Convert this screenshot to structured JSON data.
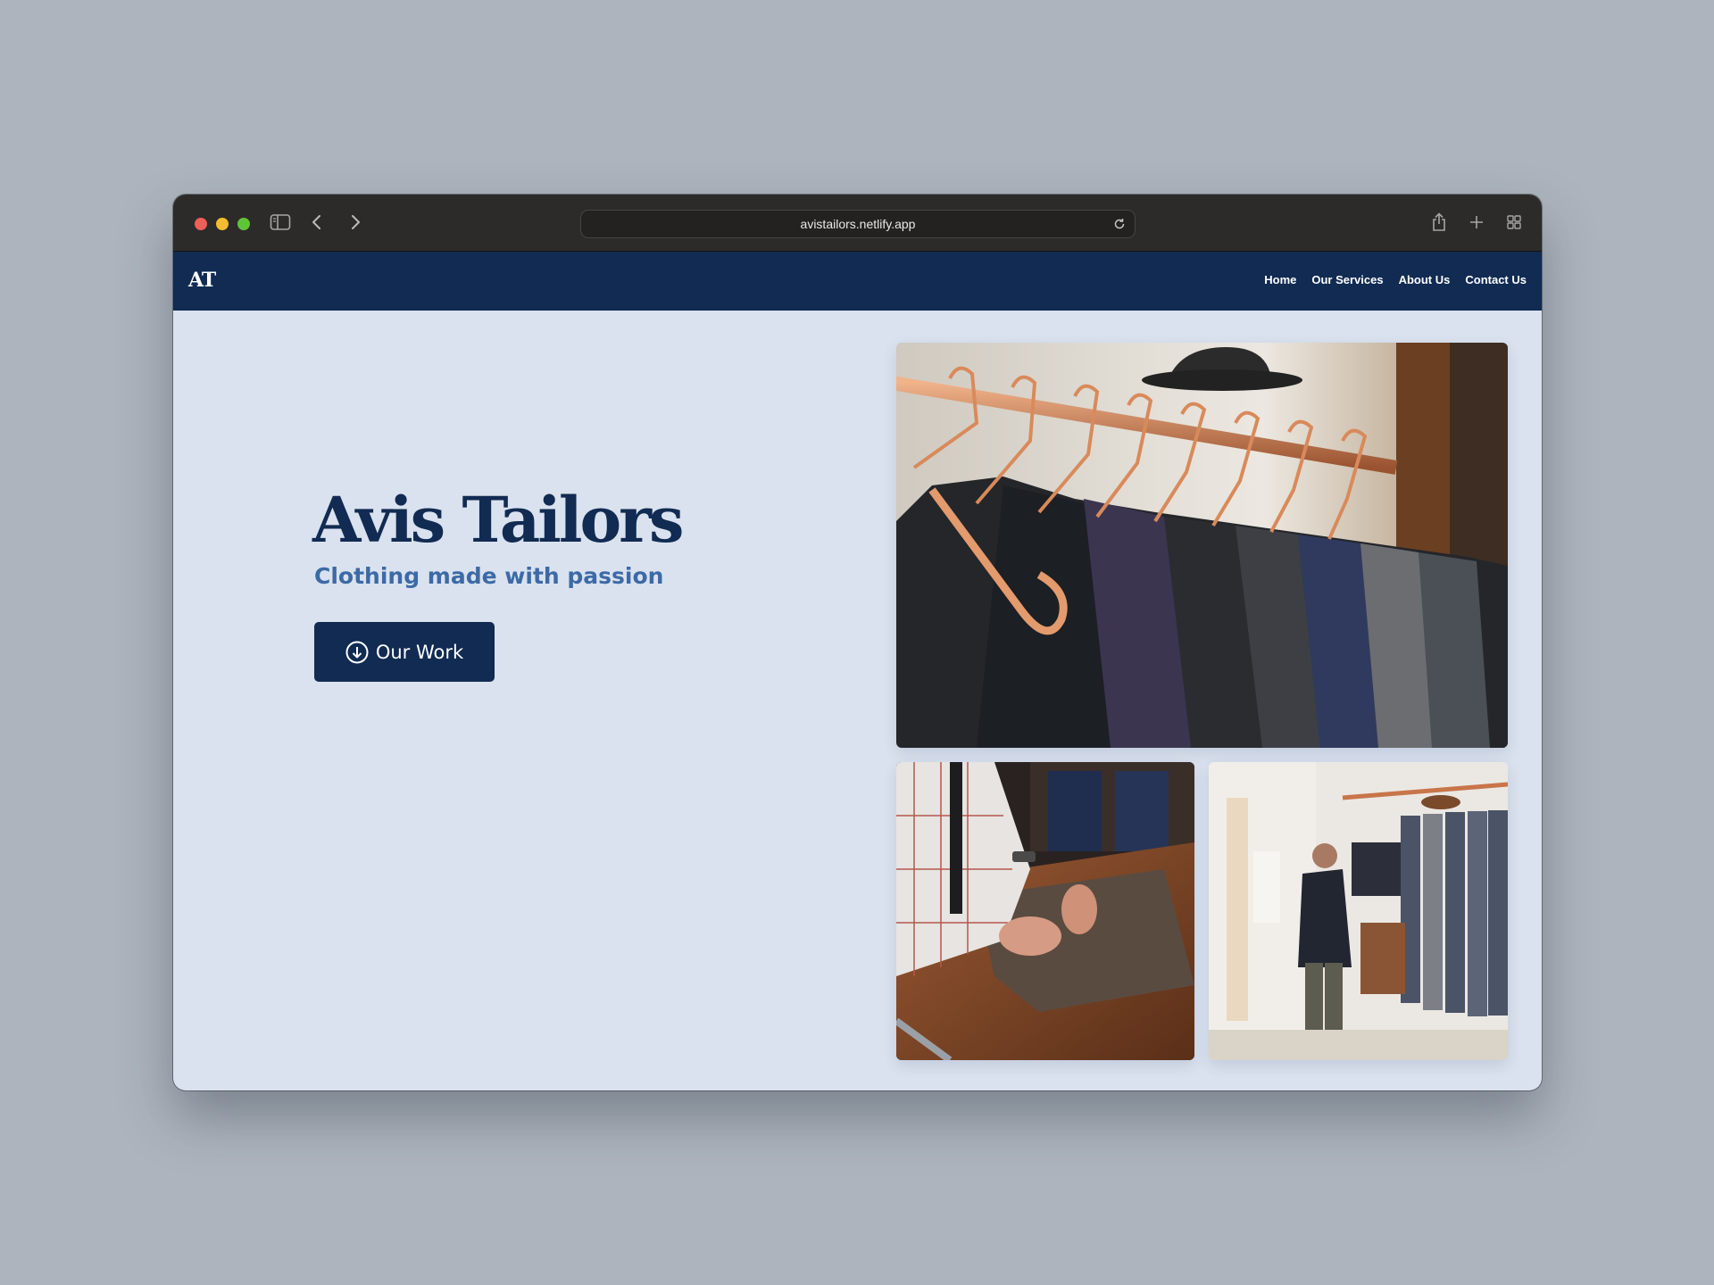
{
  "browser": {
    "url": "avistailors.netlify.app"
  },
  "site": {
    "logo": "AT",
    "nav": [
      "Home",
      "Our Services",
      "About Us",
      "Contact Us"
    ],
    "hero": {
      "title": "Avis Tailors",
      "subtitle": "Clothing made with passion",
      "cta_label": "Our Work"
    }
  },
  "colors": {
    "navy": "#112b52",
    "accent_blue": "#3c6aa6",
    "page_background": "#dae2ef"
  },
  "icons": {
    "cta": "arrow-down-circle-icon",
    "sidebar": "sidebar-icon",
    "back": "chevron-left-icon",
    "forward": "chevron-right-icon",
    "reload": "reload-icon",
    "share": "share-icon",
    "new_tab": "plus-icon",
    "tabs": "tab-overview-icon"
  }
}
